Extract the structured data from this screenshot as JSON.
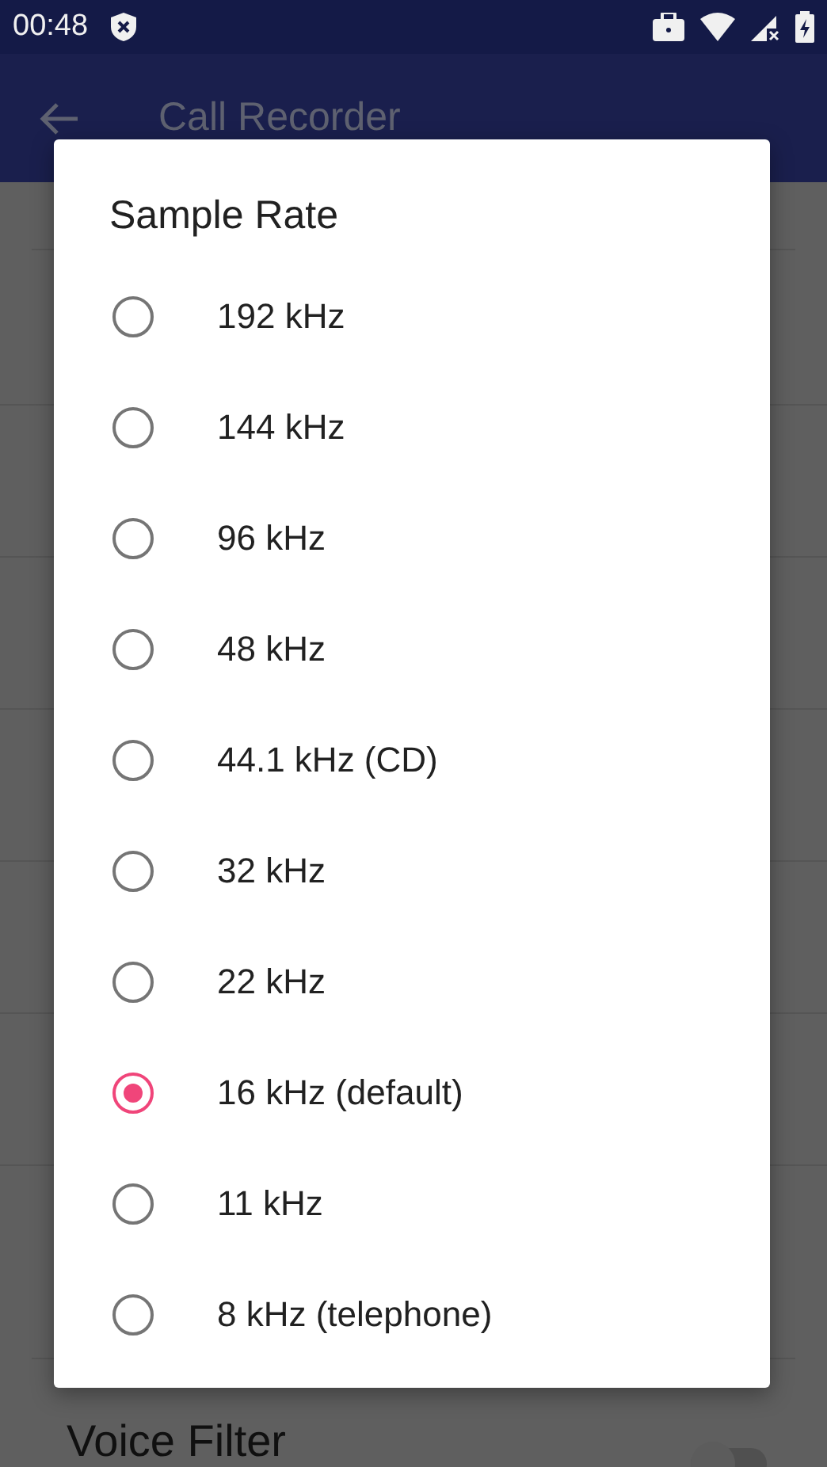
{
  "status_bar": {
    "time": "00:48"
  },
  "app_bar": {
    "title": "Call Recorder"
  },
  "settings": [
    {
      "label": "Voice Filter",
      "on": false
    }
  ],
  "dialog": {
    "title": "Sample Rate",
    "options": [
      {
        "label": "192 kHz",
        "selected": false
      },
      {
        "label": "144 kHz",
        "selected": false
      },
      {
        "label": "96 kHz",
        "selected": false
      },
      {
        "label": "48 kHz",
        "selected": false
      },
      {
        "label": "44.1 kHz (CD)",
        "selected": false
      },
      {
        "label": "32 kHz",
        "selected": false
      },
      {
        "label": "22 kHz",
        "selected": false
      },
      {
        "label": "16 kHz (default)",
        "selected": true
      },
      {
        "label": "11 kHz",
        "selected": false
      },
      {
        "label": "8 kHz (telephone)",
        "selected": false
      }
    ]
  }
}
